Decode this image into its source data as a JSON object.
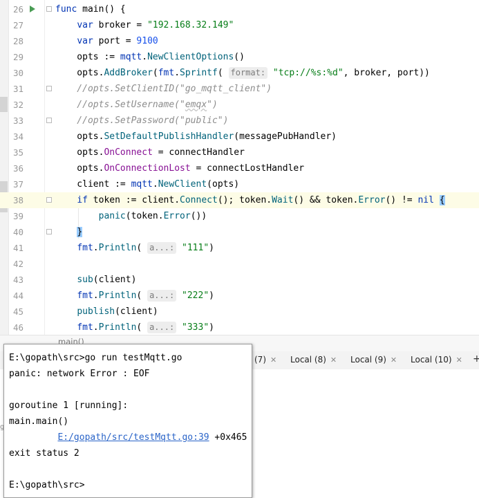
{
  "editor": {
    "lines": [
      {
        "num": "26",
        "segments": [
          [
            "kw",
            "func "
          ],
          [
            "plain",
            "main() {"
          ]
        ]
      },
      {
        "num": "27",
        "segments": [
          [
            "plain",
            "    "
          ],
          [
            "kw",
            "var "
          ],
          [
            "plain",
            "broker = "
          ],
          [
            "str",
            "\"192.168.32.149\""
          ]
        ]
      },
      {
        "num": "28",
        "segments": [
          [
            "plain",
            "    "
          ],
          [
            "kw",
            "var "
          ],
          [
            "plain",
            "port = "
          ],
          [
            "num-lit",
            "9100"
          ]
        ]
      },
      {
        "num": "29",
        "segments": [
          [
            "plain",
            "    opts := "
          ],
          [
            "pkg",
            "mqtt"
          ],
          [
            "plain",
            "."
          ],
          [
            "fn",
            "NewClientOptions"
          ],
          [
            "plain",
            "()"
          ]
        ]
      },
      {
        "num": "30",
        "segments": [
          [
            "plain",
            "    opts."
          ],
          [
            "fn",
            "AddBroker"
          ],
          [
            "plain",
            "("
          ],
          [
            "pkg",
            "fmt"
          ],
          [
            "plain",
            "."
          ],
          [
            "fn",
            "Sprintf"
          ],
          [
            "plain",
            "( "
          ],
          [
            "hint",
            "format:"
          ],
          [
            "plain",
            " "
          ],
          [
            "str",
            "\"tcp://%s:%d\""
          ],
          [
            "plain",
            ", broker, port))"
          ]
        ]
      },
      {
        "num": "31",
        "segments": [
          [
            "cmt",
            "    //opts.SetClientID(\"go_mqtt_client\")"
          ]
        ]
      },
      {
        "num": "32",
        "segments": [
          [
            "cmt",
            "    //opts.SetUsername(\""
          ],
          [
            "cmt-sq",
            "emqx"
          ],
          [
            "cmt",
            "\")"
          ]
        ]
      },
      {
        "num": "33",
        "segments": [
          [
            "cmt",
            "    //opts.SetPassword(\"public\")"
          ]
        ]
      },
      {
        "num": "34",
        "segments": [
          [
            "plain",
            "    opts."
          ],
          [
            "fn",
            "SetDefaultPublishHandler"
          ],
          [
            "plain",
            "(messagePubHandler)"
          ]
        ]
      },
      {
        "num": "35",
        "segments": [
          [
            "plain",
            "    opts."
          ],
          [
            "field",
            "OnConnect"
          ],
          [
            "plain",
            " = connectHandler"
          ]
        ]
      },
      {
        "num": "36",
        "segments": [
          [
            "plain",
            "    opts."
          ],
          [
            "field",
            "OnConnectionLost"
          ],
          [
            "plain",
            " = connectLostHandler"
          ]
        ]
      },
      {
        "num": "37",
        "segments": [
          [
            "plain",
            "    client := "
          ],
          [
            "pkg",
            "mqtt"
          ],
          [
            "plain",
            "."
          ],
          [
            "fn",
            "NewClient"
          ],
          [
            "plain",
            "(opts)"
          ]
        ]
      },
      {
        "num": "38",
        "segments": [
          [
            "plain",
            "    "
          ],
          [
            "kw",
            "if "
          ],
          [
            "plain",
            "token := client."
          ],
          [
            "fn",
            "Connect"
          ],
          [
            "plain",
            "(); token."
          ],
          [
            "fn",
            "Wait"
          ],
          [
            "plain",
            "() && token."
          ],
          [
            "fn",
            "Error"
          ],
          [
            "plain",
            "() != "
          ],
          [
            "kw",
            "nil "
          ],
          [
            "brace",
            "{"
          ]
        ]
      },
      {
        "num": "39",
        "segments": [
          [
            "plain",
            "        "
          ],
          [
            "fn",
            "panic"
          ],
          [
            "plain",
            "(token."
          ],
          [
            "fn",
            "Error"
          ],
          [
            "plain",
            "())"
          ]
        ]
      },
      {
        "num": "40",
        "segments": [
          [
            "plain",
            "    "
          ],
          [
            "brace",
            "}"
          ]
        ]
      },
      {
        "num": "41",
        "segments": [
          [
            "plain",
            "    "
          ],
          [
            "pkg",
            "fmt"
          ],
          [
            "plain",
            "."
          ],
          [
            "fn",
            "Println"
          ],
          [
            "plain",
            "( "
          ],
          [
            "hint",
            "a...:"
          ],
          [
            "plain",
            " "
          ],
          [
            "str",
            "\"111\""
          ],
          [
            "plain",
            ")"
          ]
        ]
      },
      {
        "num": "42",
        "segments": []
      },
      {
        "num": "43",
        "segments": [
          [
            "plain",
            "    "
          ],
          [
            "fn",
            "sub"
          ],
          [
            "plain",
            "(client)"
          ]
        ]
      },
      {
        "num": "44",
        "segments": [
          [
            "plain",
            "    "
          ],
          [
            "pkg",
            "fmt"
          ],
          [
            "plain",
            "."
          ],
          [
            "fn",
            "Println"
          ],
          [
            "plain",
            "( "
          ],
          [
            "hint",
            "a...:"
          ],
          [
            "plain",
            " "
          ],
          [
            "str",
            "\"222\""
          ],
          [
            "plain",
            ")"
          ]
        ]
      },
      {
        "num": "45",
        "segments": [
          [
            "plain",
            "    "
          ],
          [
            "fn",
            "publish"
          ],
          [
            "plain",
            "(client)"
          ]
        ]
      },
      {
        "num": "46",
        "segments": [
          [
            "plain",
            "    "
          ],
          [
            "pkg",
            "fmt"
          ],
          [
            "plain",
            "."
          ],
          [
            "fn",
            "Println"
          ],
          [
            "plain",
            "( "
          ],
          [
            "hint",
            "a...:"
          ],
          [
            "plain",
            " "
          ],
          [
            "str",
            "\"333\""
          ],
          [
            "plain",
            ")"
          ]
        ]
      }
    ]
  },
  "breadcrumb": "main()",
  "tabs": [
    {
      "label": "(7)"
    },
    {
      "label": "Local (8)"
    },
    {
      "label": "Local (9)"
    },
    {
      "label": "Local (10)"
    }
  ],
  "tab_add": "+",
  "console": {
    "lines": [
      {
        "text": "E:\\gopath\\src>go run testMqtt.go"
      },
      {
        "text": "panic: network Error : EOF"
      },
      {
        "text": ""
      },
      {
        "text": "goroutine 1 [running]:"
      },
      {
        "text": "main.main()"
      },
      {
        "prefix": "         ",
        "link": "E:/gopath/src/testMqtt.go:39",
        "suffix": " +0x465"
      },
      {
        "text": "exit status 2"
      },
      {
        "text": ""
      },
      {
        "text": "E:\\gopath\\src>"
      }
    ]
  },
  "icons": {
    "run": "run-icon",
    "fold": "fold-marker-icon",
    "close": "close-icon",
    "add": "add-icon"
  }
}
